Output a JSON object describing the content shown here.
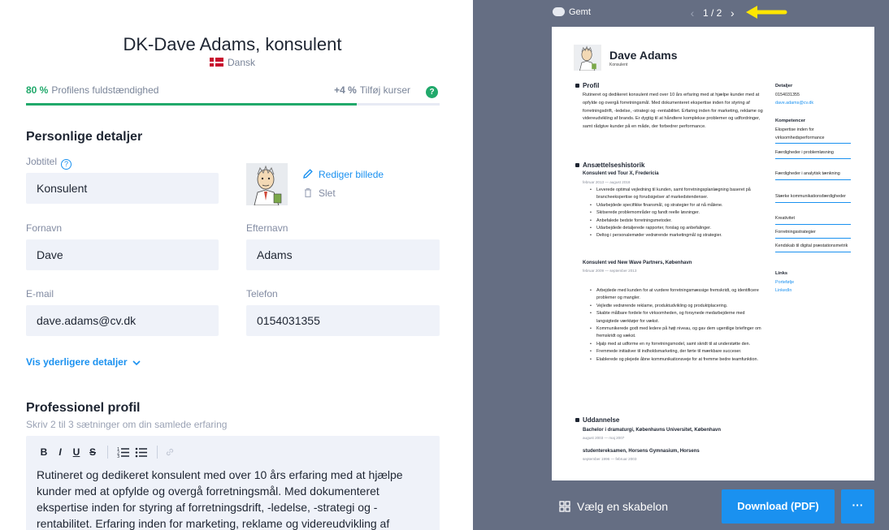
{
  "editor": {
    "title": "DK-Dave Adams, konsulent",
    "language": "Dansk",
    "progress": {
      "percent_label": "80 %",
      "percent_value": 80,
      "label": "Profilens fuldstændighed",
      "tip_plus": "+4 %",
      "tip_label": "Tilføj kurser",
      "help_badge": "?"
    },
    "personal": {
      "heading": "Personlige detaljer",
      "jobtitle_label": "Jobtitel",
      "jobtitle_value": "Konsulent",
      "edit_photo": "Rediger billede",
      "delete_photo": "Slet",
      "firstname_label": "Fornavn",
      "firstname_value": "Dave",
      "lastname_label": "Efternavn",
      "lastname_value": "Adams",
      "email_label": "E-mail",
      "email_value": "dave.adams@cv.dk",
      "phone_label": "Telefon",
      "phone_value": "0154031355",
      "more_details": "Vis yderligere detaljer"
    },
    "profile": {
      "heading": "Professionel profil",
      "hint": "Skriv 2 til 3 sætninger om din samlede erfaring",
      "toolbar": {
        "bold": "B",
        "italic": "I",
        "underline": "U",
        "strike": "S"
      },
      "text": " Rutineret og dedikeret konsulent med over 10 års erfaring med at hjælpe kunder med at opfylde og overgå forretningsmål. Med dokumenteret ekspertise inden for styring af forretningsdrift, -ledelse, -strategi og -rentabilitet. Erfaring inden for marketing, reklame og videreudvikling af"
    }
  },
  "preview": {
    "saved": "Gemt",
    "page_counter": "1 / 2",
    "template_button": "Vælg en skabelon",
    "download_button": "Download (PDF)",
    "more_button": "···",
    "resume": {
      "name": "Dave Adams",
      "role": "Konsulent",
      "profile_heading": "Profil",
      "profile_text": "Rutineret og dedikeret konsulent med over 10 års erfaring med at hjælpe kunder med at opfylde og overgå forretningsmål. Med dokumenteret ekspertise inden for styring af forretningsdrift, -ledelse, -strategi og -rentabilitet. Erfaring inden for marketing, reklame og videreudvikling af brands. Er dygtig til at håndtere komplekse problemer og udfordringer, samt rådgive kunder på en måde, der forbedrer performance.",
      "employment_heading": "Ansættelseshistorik",
      "job1_title": "Konsulent ved Tour X, Fredericia",
      "job1_date": "februar 2013 — august 2018",
      "job1_items": [
        "Leverede optimal vejledning til kunden, samt forretningsplanlægning baseret på brancheekspertise og forudsigelser af markedstendenser.",
        "Udarbejdede specifikke finansmål, og strategier for at nå målene.",
        "Skitserede problemområder og fandt reelle løsninger.",
        "Anbefalede bedste forretningsmetoder.",
        "Udarbejdede detaljerede rapporter, forslag og anbefalinger.",
        "Deltog i personalemøder vedrørende marketingmål og strategier."
      ],
      "job2_title": "Konsulent ved New Wave Partners, København",
      "job2_date": "februar 2009 — september 2013",
      "job2_items": [
        "Arbejdede med kunden for at vurdere forretningsmæssige fremskridt, og identificere problemer og mangler.",
        "Vejledte vedrørende reklame, produktudvikling og produktplacering.",
        "Skabte målbare fordele for virksomheden, og forsynede medarbejderne med langsigtede værktøjer for vækst.",
        "Kommunikerede godt med ledere på højt niveau, og gav dem ugentlige briefinger om fremskridt og vækst.",
        "Hjalp med at udforme en ny forretningsmodel, samt skridt til at understøtte den.",
        "Fremmede initiativer til indholdsmarketing, der førte til mærkbare succeser.",
        "Etablerede og plejede åbne kommunikationsveje for at fremme bedre teamfunktion."
      ],
      "education_heading": "Uddannelse",
      "edu1_title": "Bachelor i dramaturgi, Københavns Universitet, København",
      "edu1_date": "august 2003 — maj 2007",
      "edu2_title": "studentereksamen, Horsens Gymnasium, Horsens",
      "edu2_date": "september 1996 — februar 2003",
      "details_heading": "Detaljer",
      "details_phone": "0154031355",
      "details_email": "dave.adams@cv.dk",
      "skills_heading": "Kompetencer",
      "skills": [
        "Ekspertise inden for virksomhedsperformance",
        "Færdigheder i problemløsning",
        "Færdigheder i analytisk tænkning",
        "Stærke kommunikationsfærdigheder",
        "Kreativitet",
        "Forretningsstrategier",
        "Kendskab til digital præstationsmetrik"
      ],
      "links_heading": "Links",
      "link1": "Portefølje",
      "link2": "LinkedIn"
    }
  },
  "colors": {
    "accent_blue": "#1a91f0",
    "progress_green": "#21a96b",
    "preview_bg": "#656e83",
    "field_bg": "#eff2f9",
    "annotation_arrow": "#ffe600"
  }
}
